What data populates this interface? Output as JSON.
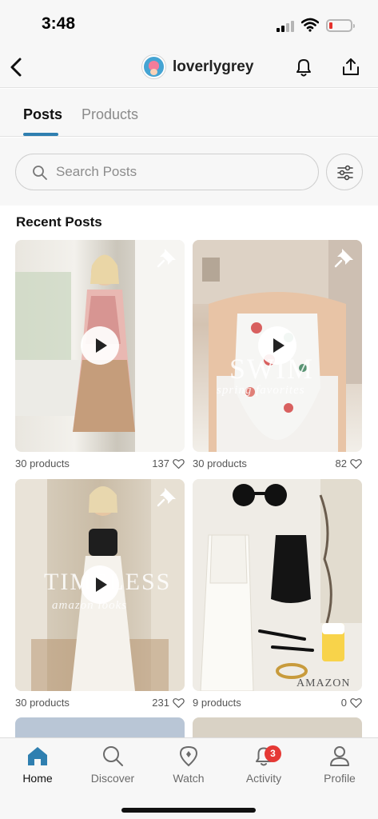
{
  "status_bar": {
    "time": "3:48"
  },
  "header": {
    "profile_name": "loverlygrey"
  },
  "tabs": [
    {
      "label": "Posts",
      "active": true
    },
    {
      "label": "Products",
      "active": false
    }
  ],
  "search": {
    "placeholder": "Search Posts"
  },
  "recent_posts": {
    "title": "Recent Posts",
    "posts": [
      {
        "products": "30 products",
        "likes": "137",
        "overlay_text": "",
        "pinned": true,
        "video": true
      },
      {
        "products": "30 products",
        "likes": "82",
        "overlay_text": "SWIM",
        "overlay_sub": "spring favorites",
        "pinned": true,
        "video": true
      },
      {
        "products": "30 products",
        "likes": "231",
        "overlay_text": "TIMELESS",
        "overlay_sub": "amazon looks",
        "pinned": true,
        "video": true
      },
      {
        "products": "9 products",
        "likes": "0",
        "overlay_text": "AMAZON",
        "pinned": false,
        "video": false
      }
    ]
  },
  "bottom_nav": {
    "items": [
      {
        "label": "Home",
        "icon": "home-icon",
        "active": true
      },
      {
        "label": "Discover",
        "icon": "search-icon",
        "active": false
      },
      {
        "label": "Watch",
        "icon": "watch-icon",
        "active": false
      },
      {
        "label": "Activity",
        "icon": "bell-icon",
        "active": false,
        "badge": "3"
      },
      {
        "label": "Profile",
        "icon": "user-icon",
        "active": false
      }
    ]
  },
  "colors": {
    "accent": "#2f7fb0",
    "badge": "#e53935",
    "battery_low": "#e5322d"
  }
}
